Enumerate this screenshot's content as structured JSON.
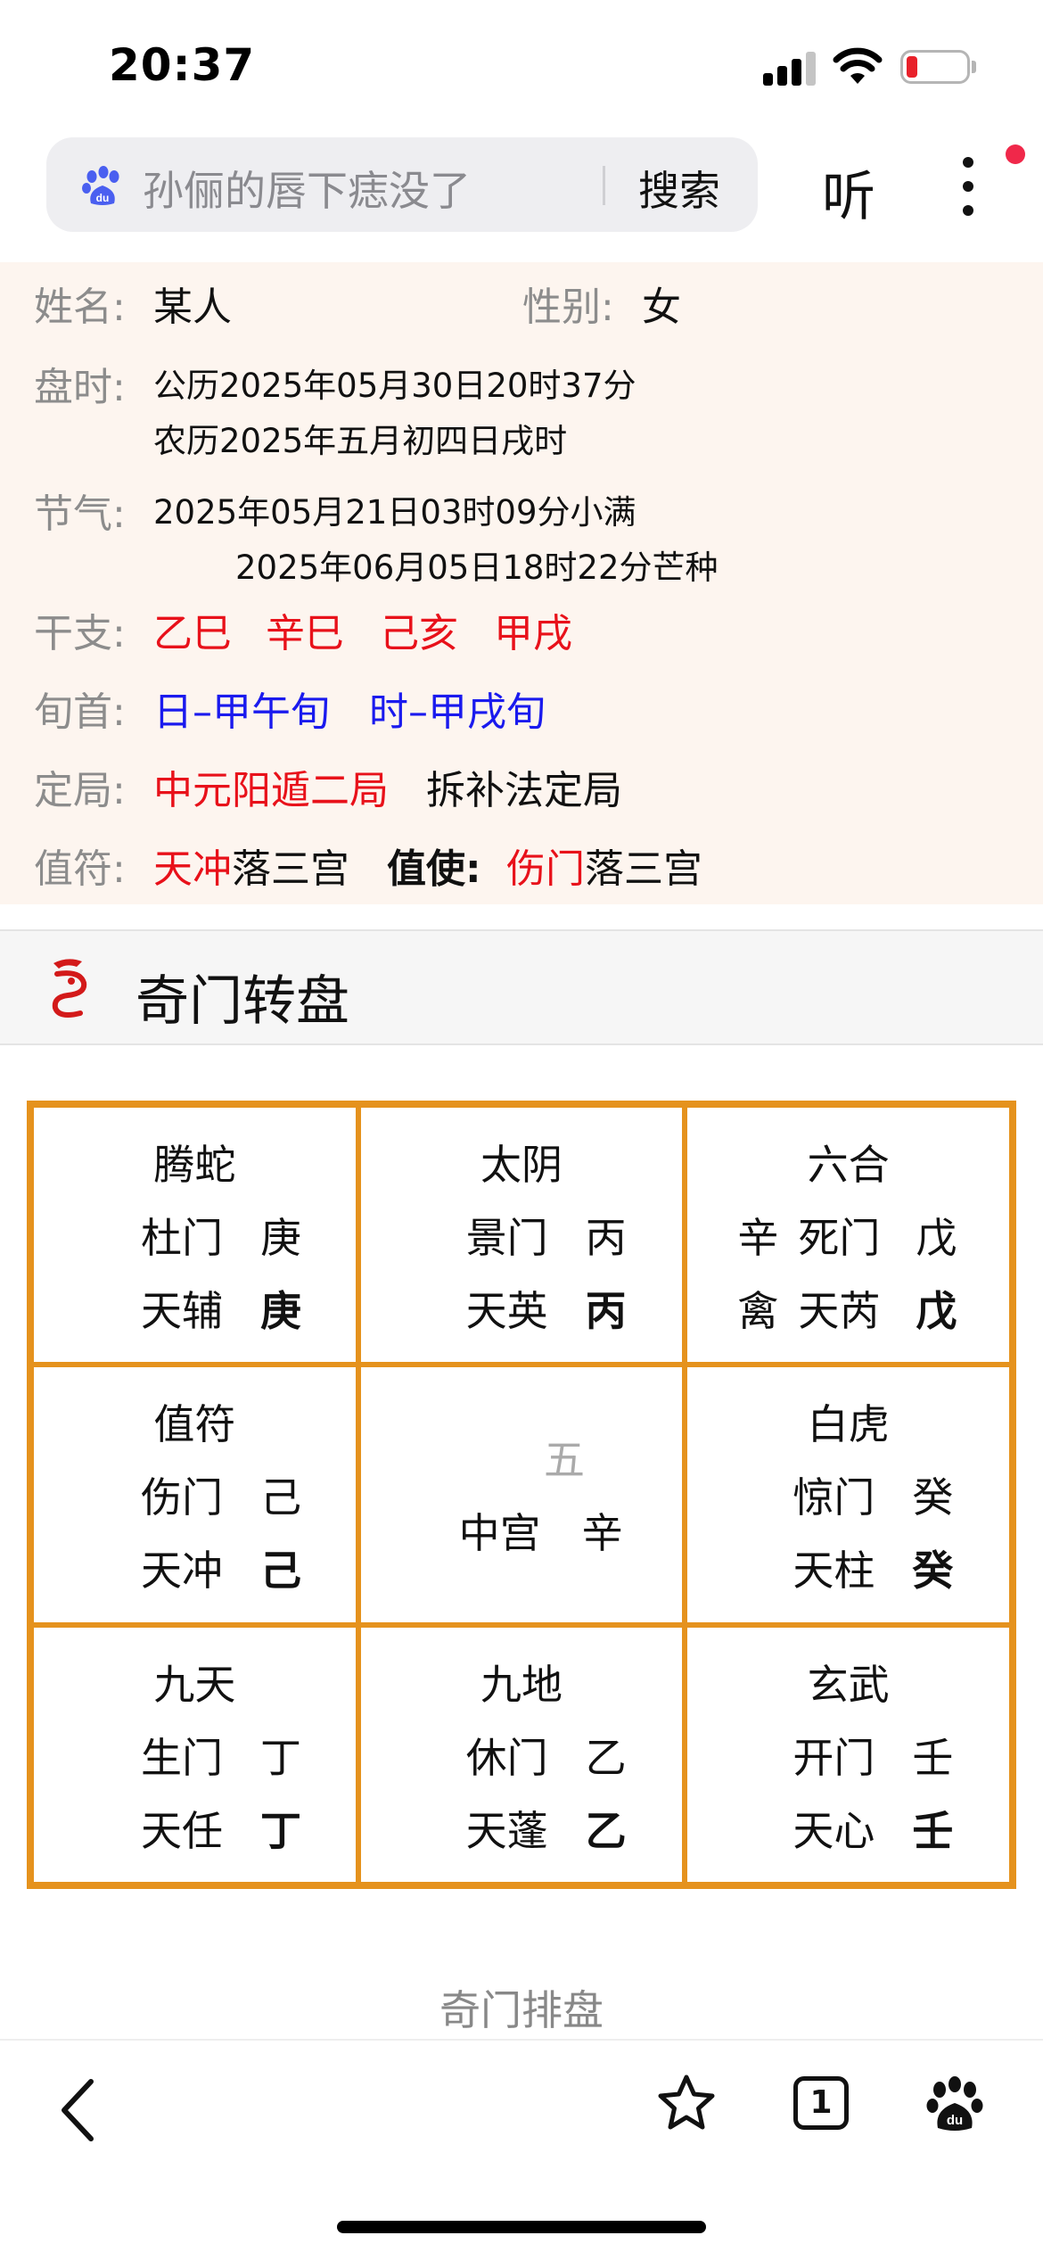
{
  "status": {
    "time": "20:37"
  },
  "search": {
    "query": "孙俪的唇下痣没了",
    "button": "搜索",
    "listen": "听"
  },
  "info": {
    "name_label": "姓名:",
    "name": "某人",
    "gender_label": "性别:",
    "gender": "女",
    "time_label": "盘时:",
    "solar": "公历2025年05月30日20时37分",
    "lunar": "农历2025年五月初四日戌时",
    "term_label": "节气:",
    "term1": "2025年05月21日03时09分小满",
    "term2": "2025年06月05日18时22分芒种",
    "ganzhi_label": "干支:",
    "ganzhi": [
      "乙巳",
      "辛巳",
      "己亥",
      "甲戌"
    ],
    "xunshou_label": "旬首:",
    "xunshou_day": "日–甲午旬",
    "xunshou_hour": "时–甲戌旬",
    "ju_label": "定局:",
    "ju": "中元阳遁二局",
    "ju_method": "拆补法定局",
    "zhifu_label": "值符:",
    "zhifu_star": "天冲",
    "zhifu_rest": "落三宫",
    "zhishi_label": "值使:",
    "zhishi_door": "伤门",
    "zhishi_rest": "落三宫"
  },
  "section": {
    "title": "奇门转盘"
  },
  "palaces": [
    {
      "god": "腾蛇",
      "door": "杜门",
      "door_stem": "庚",
      "star": "天辅",
      "star_stem": "庚"
    },
    {
      "god": "太阴",
      "door": "景门",
      "door_stem": "丙",
      "star": "天英",
      "star_stem": "丙"
    },
    {
      "god": "六合",
      "door_pre": "辛",
      "door": "死门",
      "door_stem": "戊",
      "star_pre": "禽",
      "star": "天芮",
      "star_stem": "戊"
    },
    {
      "god": "值符",
      "door": "伤门",
      "door_stem": "己",
      "star": "天冲",
      "star_stem": "己"
    },
    {
      "five": "五",
      "center": "中宫",
      "center_stem": "辛"
    },
    {
      "god": "白虎",
      "door": "惊门",
      "door_stem": "癸",
      "star": "天柱",
      "star_stem": "癸"
    },
    {
      "god": "九天",
      "door": "生门",
      "door_stem": "丁",
      "star": "天任",
      "star_stem": "丁"
    },
    {
      "god": "九地",
      "door": "休门",
      "door_stem": "乙",
      "star": "天蓬",
      "star_stem": "乙"
    },
    {
      "god": "玄武",
      "door": "开门",
      "door_stem": "壬",
      "star": "天心",
      "star_stem": "壬"
    }
  ],
  "footer": {
    "link": "奇门排盘"
  },
  "bottombar": {
    "tabs_count": "1"
  },
  "colors": {
    "accent_red": "#e8111a",
    "accent_blue": "#1a1aee",
    "grid_border": "#e5921d",
    "info_bg": "#fdf5ef"
  },
  "icons": [
    "signal-icon",
    "wifi-icon",
    "battery-icon",
    "baidu-paw-icon",
    "more-icon",
    "dragon-logo-icon",
    "back-icon",
    "star-icon",
    "tabs-icon",
    "baidu-icon"
  ]
}
